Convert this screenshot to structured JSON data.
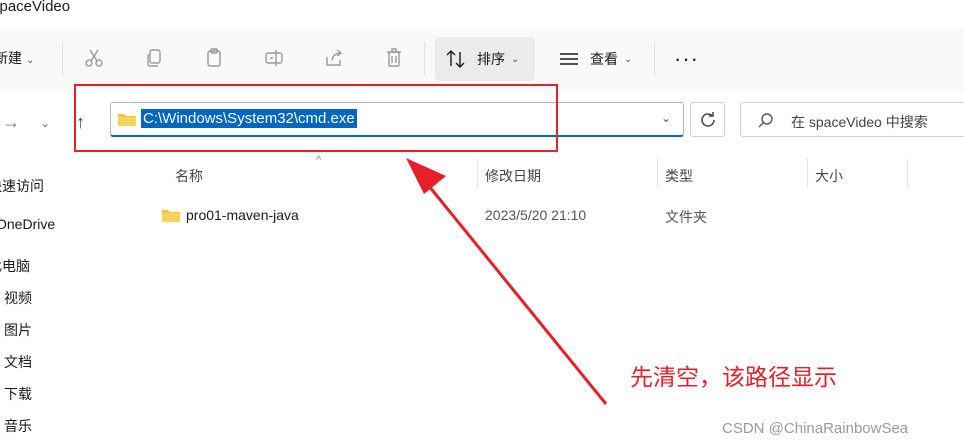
{
  "window": {
    "title": "spaceVideo"
  },
  "toolbar": {
    "new_label": "新建",
    "sort_label": "排序",
    "view_label": "查看",
    "more_label": "···"
  },
  "address": {
    "path": "C:\\Windows\\System32\\cmd.exe",
    "search_placeholder": "在 spaceVideo 中搜索"
  },
  "sidebar": {
    "items": [
      {
        "label": "快速访问"
      },
      {
        "label": "OneDrive"
      },
      {
        "label": "此电脑"
      },
      {
        "label": "视频"
      },
      {
        "label": "图片"
      },
      {
        "label": "文档"
      },
      {
        "label": "下载"
      },
      {
        "label": "音乐"
      }
    ]
  },
  "columns": {
    "name": "名称",
    "modified": "修改日期",
    "type": "类型",
    "size": "大小"
  },
  "files": [
    {
      "name": "pro01-maven-java",
      "modified": "2023/5/20 21:10",
      "type": "文件夹",
      "size": ""
    }
  ],
  "annotation": {
    "text": "先清空，该路径显示",
    "color": "#e5202a"
  },
  "watermark": {
    "text": "CSDN @ChinaRainbowSea"
  },
  "colors": {
    "accent": "#0067c0",
    "annotation_red": "#e5202a",
    "folder": "#f5c141"
  }
}
